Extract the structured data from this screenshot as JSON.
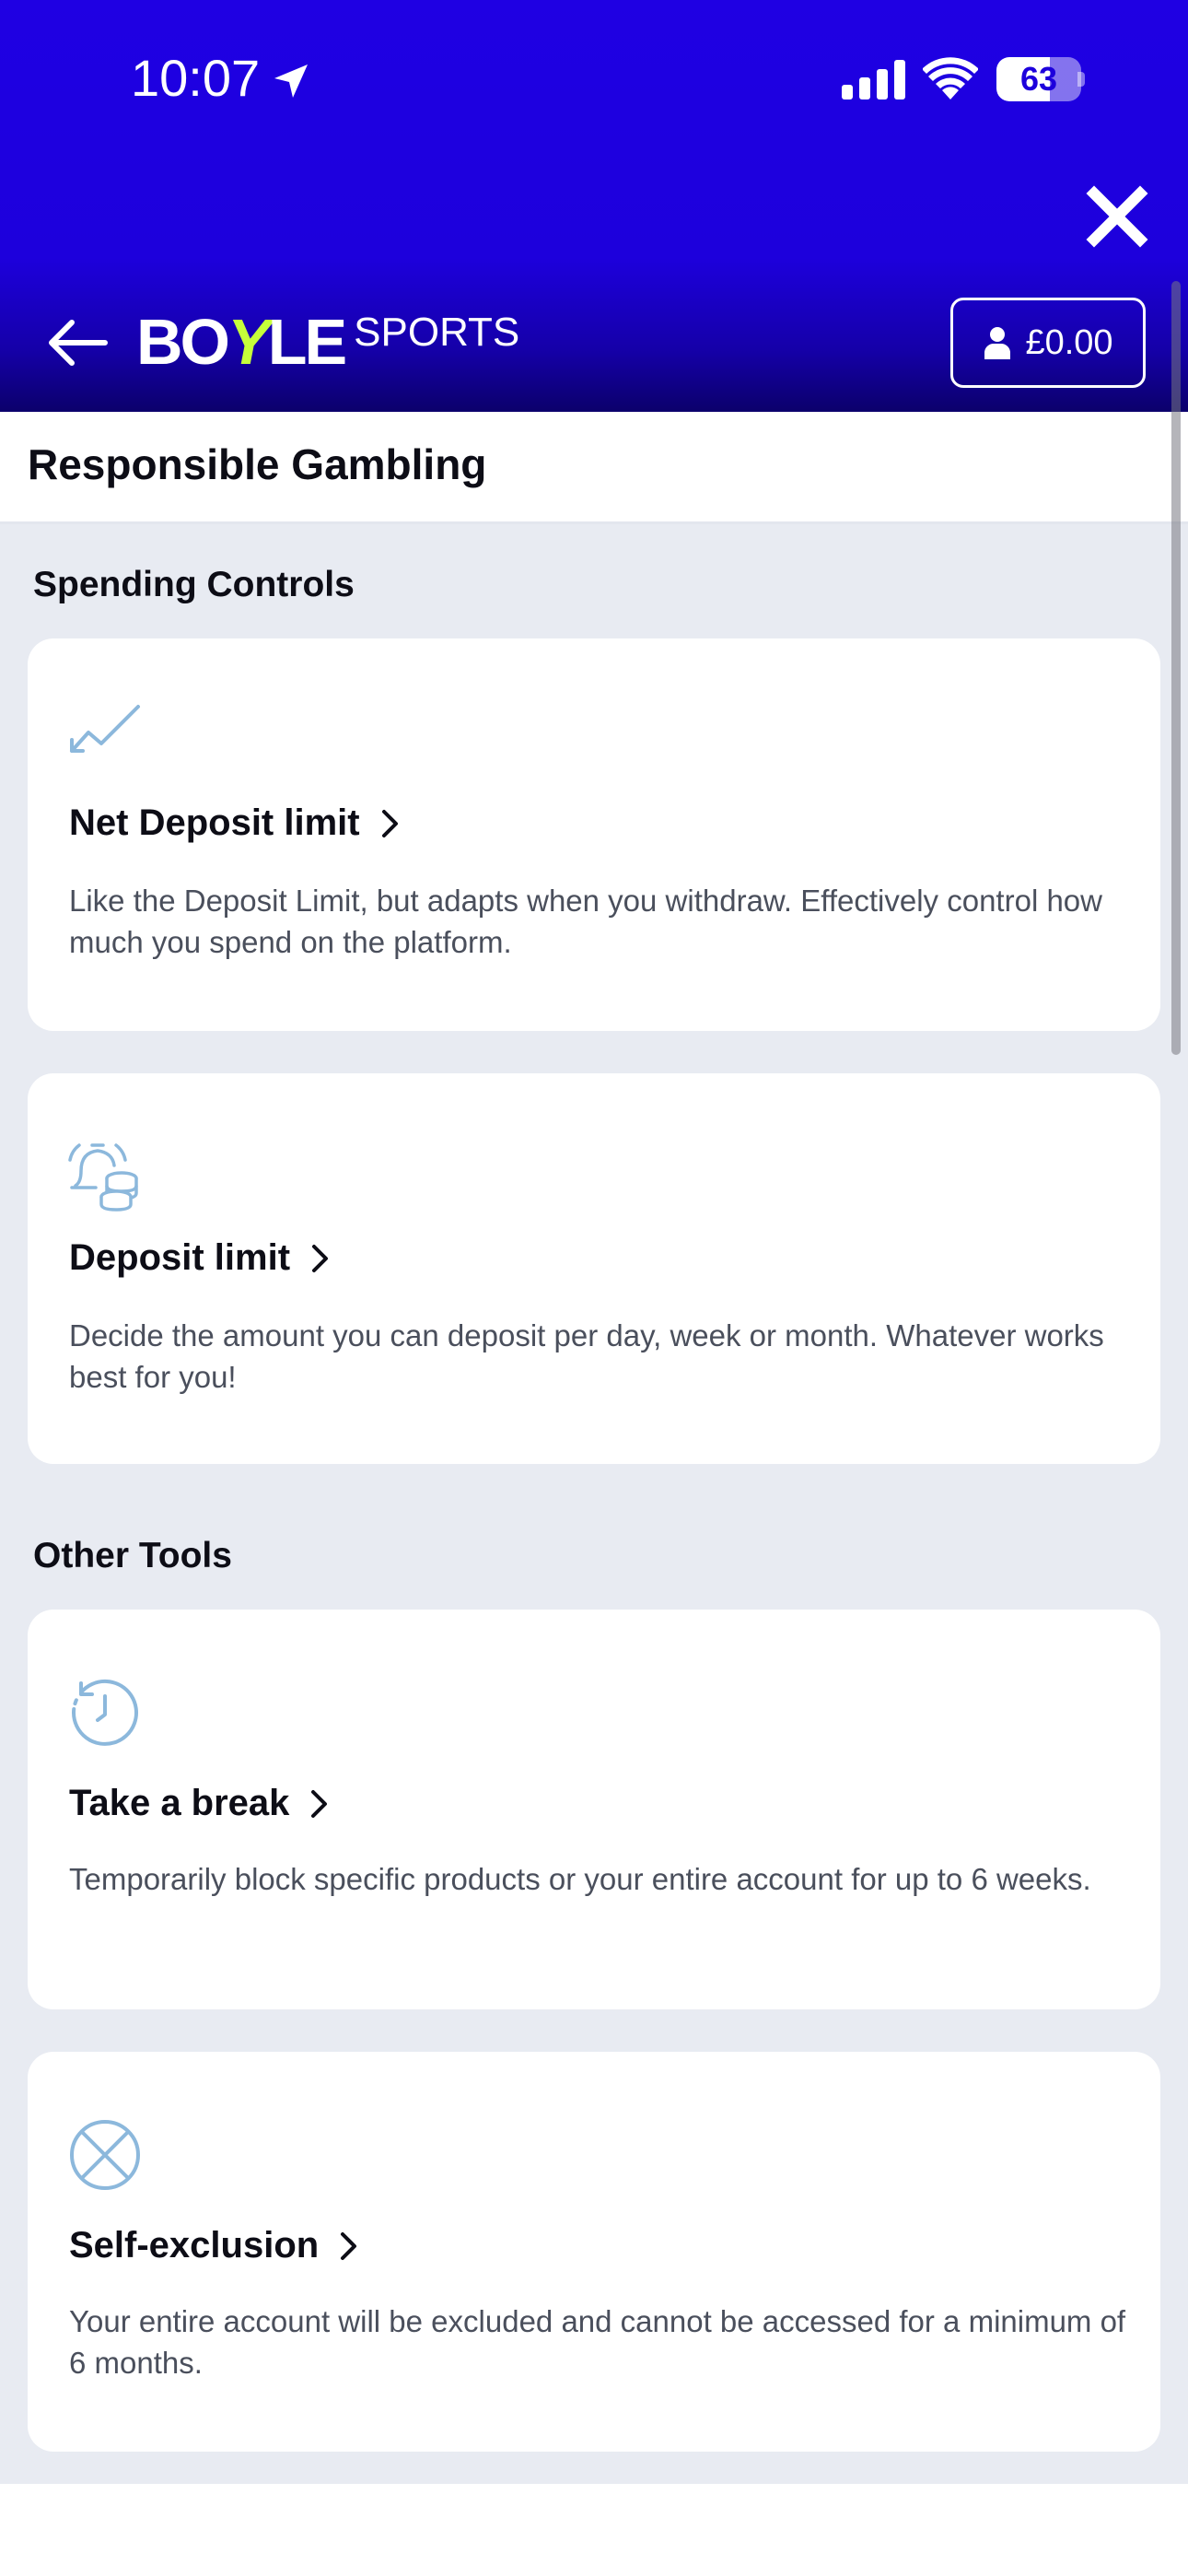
{
  "status_bar": {
    "time": "10:07",
    "battery_level": "63",
    "battery_fraction": 0.63
  },
  "header": {
    "logo_main_1": "BO",
    "logo_main_y": "Y",
    "logo_main_2": "LE",
    "logo_sports": "SPORTS",
    "balance": "£0.00",
    "accent_color": "#c6ff3a",
    "brand_color": "#1d00dc"
  },
  "page": {
    "title": "Responsible Gambling"
  },
  "sections": [
    {
      "heading": "Spending Controls",
      "cards": [
        {
          "icon": "trend-chart-icon",
          "title": "Net Deposit limit",
          "description": "Like the Deposit Limit, but adapts when you withdraw. Effectively control how much you spend on the platform."
        },
        {
          "icon": "bell-coins-icon",
          "title": "Deposit limit",
          "description": "Decide the amount you can deposit per day, week or month. Whatever works best for you!"
        }
      ]
    },
    {
      "heading": "Other Tools",
      "cards": [
        {
          "icon": "clock-history-icon",
          "title": "Take a break",
          "description": "Temporarily block specific products or your entire account for up to 6 weeks."
        },
        {
          "icon": "circle-x-icon",
          "title": "Self-exclusion",
          "description": "Your entire account will be excluded and cannot be accessed for a minimum of 6 months."
        }
      ]
    }
  ]
}
